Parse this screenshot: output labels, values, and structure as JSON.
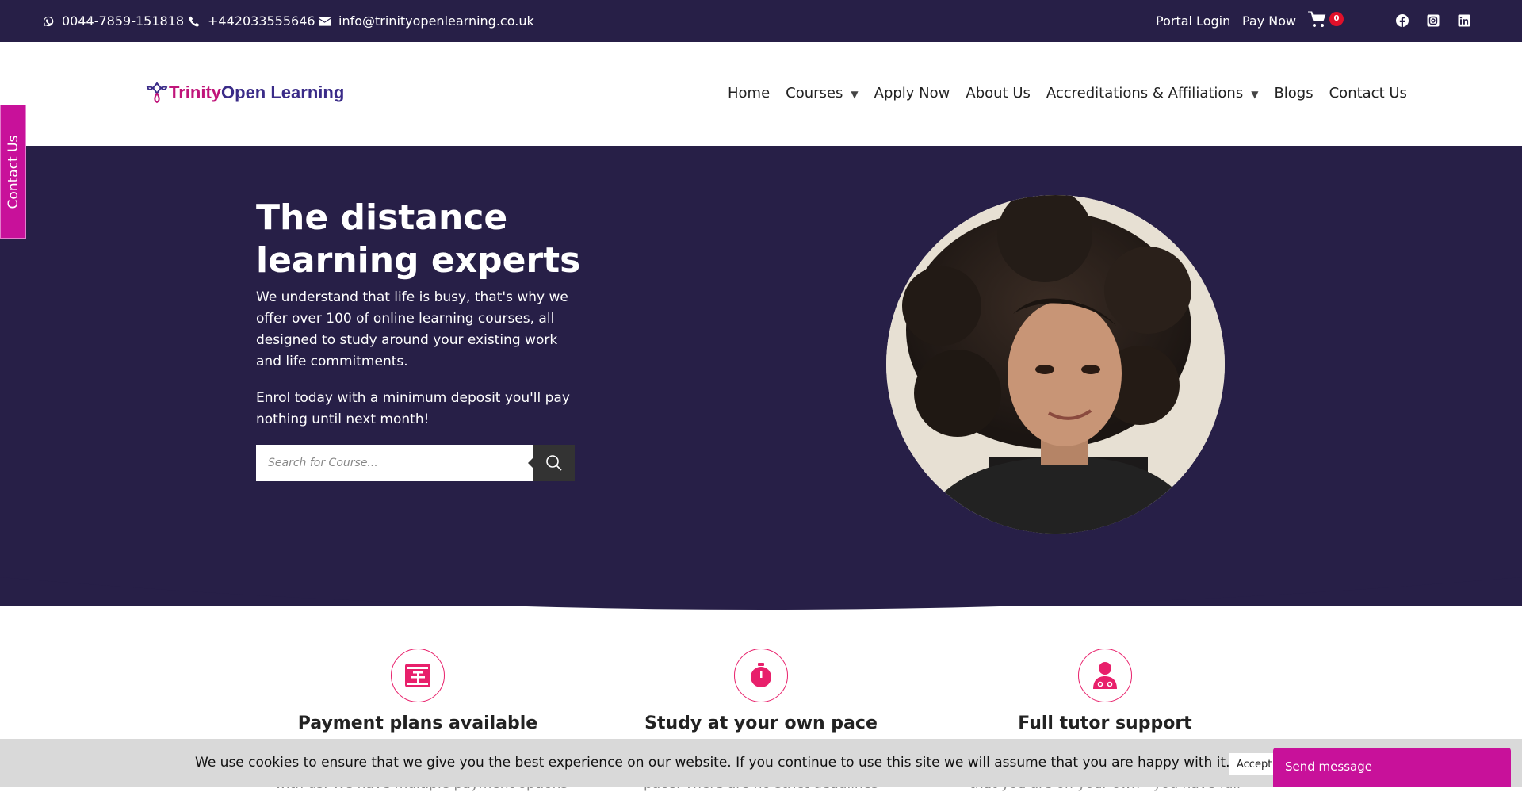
{
  "topbar": {
    "whatsapp": "0044-7859-151818",
    "phone": "+442033555646",
    "email": "info@trinityopenlearning.co.uk",
    "portal_login": "Portal Login",
    "pay_now": "Pay Now",
    "cart_count": "0",
    "social_icons": [
      "facebook-icon",
      "instagram-icon",
      "linkedin-icon"
    ]
  },
  "logo": {
    "part1": "Trinity",
    "part2": "Open Learning"
  },
  "nav": {
    "home": "Home",
    "courses": "Courses",
    "apply": "Apply Now",
    "about": "About Us",
    "accreditations": "Accreditations & Affiliations",
    "blogs": "Blogs",
    "contact": "Contact Us"
  },
  "side_tab": "Contact Us",
  "hero": {
    "title": "The distance learning experts",
    "paragraph1": "We understand that life is busy, that's why we offer over 100 of online learning courses, all designed to study around your existing work and life commitments.",
    "paragraph2": "Enrol today with a minimum deposit you'll pay nothing until next month!",
    "search_placeholder": "Search for Course..."
  },
  "features": [
    {
      "title": "Payment plans available",
      "sub": "with us. We have multiple payment options",
      "icon": "calendar-icon"
    },
    {
      "title": "Study at your own pace",
      "sub": "pace. There are no strict deadlines",
      "icon": "stopwatch-icon"
    },
    {
      "title": "Full tutor support",
      "sub": "that you are on your own - you have full",
      "icon": "tutor-icon"
    }
  ],
  "cookie": {
    "text": "We use cookies to ensure that we give you the best experience on our website. If you continue to use this site we will assume that you are happy with it.",
    "accept": "Accept"
  },
  "chat": {
    "label": "Send message"
  },
  "colors": {
    "navy": "#271f47",
    "magenta": "#c8119a",
    "pink": "#e8206b"
  }
}
